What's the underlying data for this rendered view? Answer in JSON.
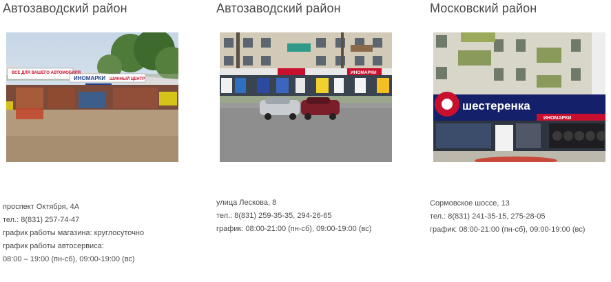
{
  "stores": [
    {
      "district": "Автозаводский район",
      "photo_subject": "tire-shop-pavilion",
      "photo_sign_texts": [
        "ВСЕ ДЛЯ ВАШЕГО АВТОМОБИЛЯ",
        "ИНОМАРКИ",
        "ШИННЫЙ ЦЕНТР"
      ],
      "address": "проспект Октября, 4А",
      "phone": "тел.: 8(831) 257-74-47",
      "lines": [
        "график работы магазина: круглосуточно",
        "график работы автосервиса:",
        "08:00 – 19:00 (пн-сб), 09:00-19:00 (вс)"
      ]
    },
    {
      "district": "Автозаводский район",
      "photo_subject": "apartment-building-storefront",
      "photo_sign_texts": [
        "ИНОМАРКИ"
      ],
      "address": "улица Лескова, 8",
      "phone": "тел.: 8(831) 259-35-35, 294-26-65",
      "lines": [
        "график: 08:00-21:00 (пн-сб), 09:00-19:00 (вс)"
      ]
    },
    {
      "district": "Московский район",
      "photo_subject": "shesterenka-store",
      "photo_sign_texts": [
        "шестеренка",
        "ИНОМАРКИ"
      ],
      "address": "Сормовское шоссе, 13",
      "phone": "тел.: 8(831) 241-35-15, 275-28-05",
      "lines": [
        "график: 08:00-21:00 (пн-сб), 09:00-19:00 (вс)"
      ]
    }
  ],
  "colors": {
    "text": "#4a4a4a",
    "sign_red": "#c8102e",
    "sign_blue": "#1c3f8a"
  }
}
